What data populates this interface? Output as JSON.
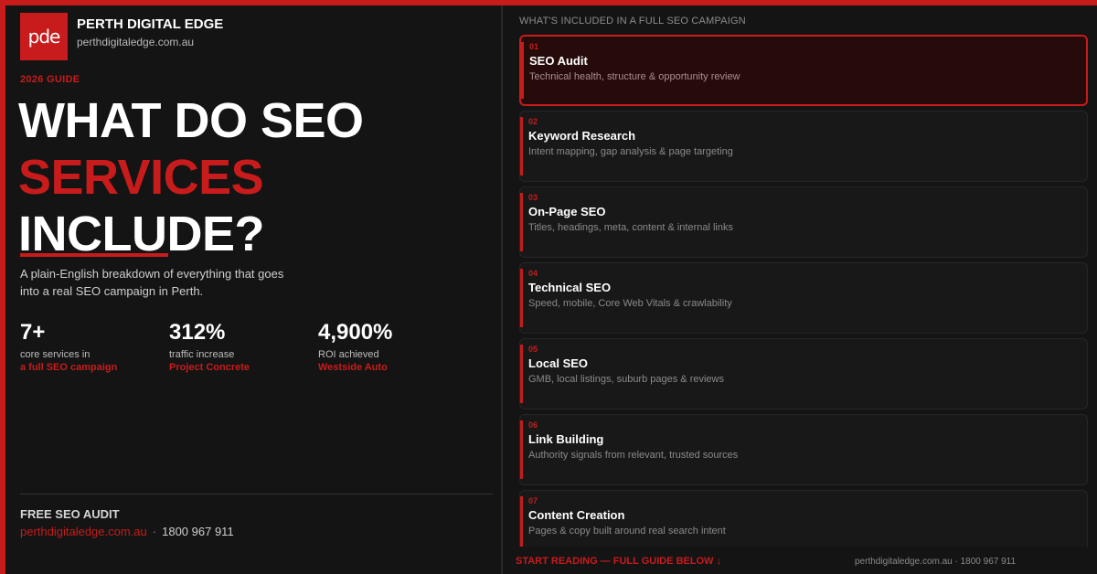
{
  "brand": {
    "logo_text": "pde",
    "name": "PERTH DIGITAL EDGE",
    "url": "perthdigitaledge.com.au"
  },
  "hero": {
    "eyebrow": "2026 GUIDE",
    "line1": "WHAT DO SEO",
    "line2": "SERVICES",
    "line3": "INCLUDE?",
    "lede": "A plain-English breakdown of everything that goes into a real SEO campaign in Perth."
  },
  "stats": [
    {
      "value": "7+",
      "label": "core services in",
      "sub": "a full SEO campaign"
    },
    {
      "value": "312%",
      "label": "traffic increase",
      "sub": "Project Concrete"
    },
    {
      "value": "4,900%",
      "label": "ROI achieved",
      "sub": "Westside Auto"
    }
  ],
  "cta": {
    "title": "FREE SEO AUDIT",
    "url": "perthdigitaledge.com.au",
    "separator": "·",
    "phone": "1800 967 911"
  },
  "services": {
    "header": "WHAT'S INCLUDED IN A FULL SEO CAMPAIGN",
    "items": [
      {
        "no": "01",
        "title": "SEO Audit",
        "desc": "Technical health, structure & opportunity review"
      },
      {
        "no": "02",
        "title": "Keyword Research",
        "desc": "Intent mapping, gap analysis & page targeting"
      },
      {
        "no": "03",
        "title": "On-Page SEO",
        "desc": "Titles, headings, meta, content & internal links"
      },
      {
        "no": "04",
        "title": "Technical SEO",
        "desc": "Speed, mobile, Core Web Vitals & crawlability"
      },
      {
        "no": "05",
        "title": "Local SEO",
        "desc": "GMB, local listings, suburb pages & reviews"
      },
      {
        "no": "06",
        "title": "Link Building",
        "desc": "Authority signals from relevant, trusted sources"
      },
      {
        "no": "07",
        "title": "Content Creation",
        "desc": "Pages & copy built around real search intent"
      }
    ]
  },
  "footer": {
    "cta": "START READING — FULL GUIDE BELOW ↓",
    "contact": "perthdigitaledge.com.au · 1800 967 911"
  },
  "colors": {
    "accent": "#c81b1b",
    "background": "#141414",
    "card": "#181818",
    "active_card": "#260b0b"
  }
}
